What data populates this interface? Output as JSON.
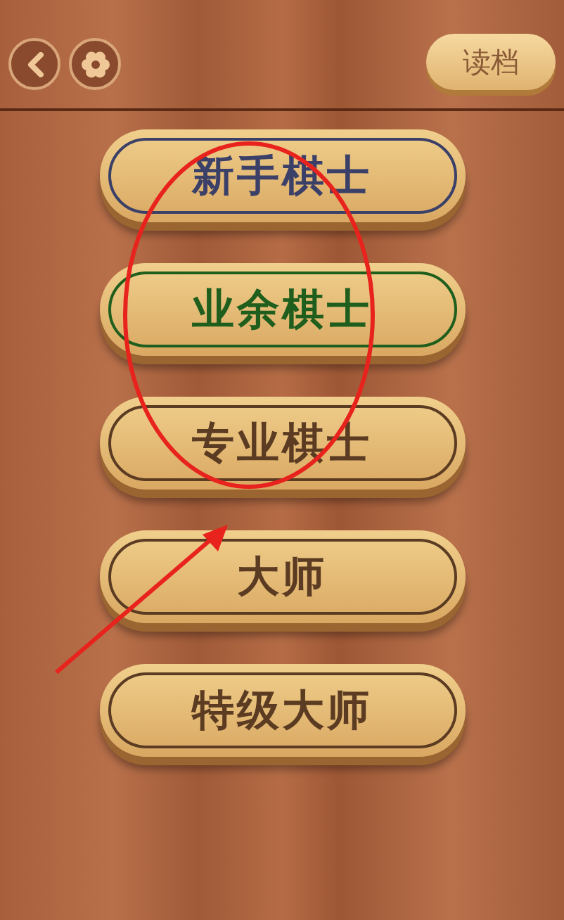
{
  "top_bar": {
    "load_button": "读档"
  },
  "levels": [
    {
      "label": "新手棋士",
      "color": "#3b4068"
    },
    {
      "label": "业余棋士",
      "color": "#1f5e1c"
    },
    {
      "label": "专业棋士",
      "color": "#5b3b22"
    },
    {
      "label": "大师",
      "color": "#5b3b22"
    },
    {
      "label": "特级大师",
      "color": "#5b3b22"
    }
  ],
  "annotation": {
    "kind": "circle-and-arrow"
  }
}
